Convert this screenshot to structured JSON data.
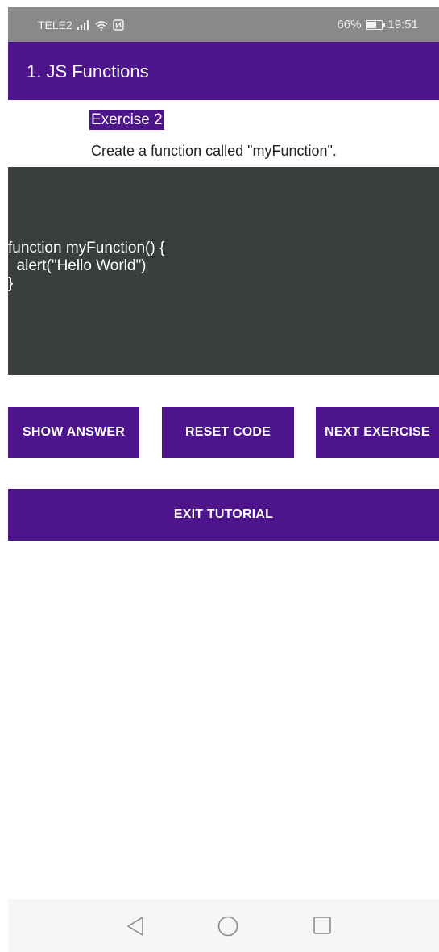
{
  "status_bar": {
    "carrier": "TELE2",
    "battery": "66%",
    "time": "19:51",
    "icons": [
      "signal-icon",
      "wifi-icon",
      "nfc-icon",
      "battery-icon"
    ]
  },
  "app_bar": {
    "title": "1. JS Functions"
  },
  "exercise": {
    "label": "Exercise 2",
    "instruction": "Create a function called \"myFunction\".",
    "code": "function myFunction() {\n  alert(\"Hello World\")\n}"
  },
  "buttons": {
    "show_answer": "SHOW ANSWER",
    "reset_code": "RESET CODE",
    "next_exercise": "NEXT EXERCISE",
    "exit_tutorial": "EXIT TUTORIAL"
  },
  "nav_bar": {
    "icons": [
      "back-icon",
      "home-icon",
      "recents-icon"
    ]
  },
  "colors": {
    "accent": "#4d148c",
    "status_bar": "#898989",
    "code_background": "#3a3e3e",
    "nav_bar": "#f6f6f6"
  }
}
